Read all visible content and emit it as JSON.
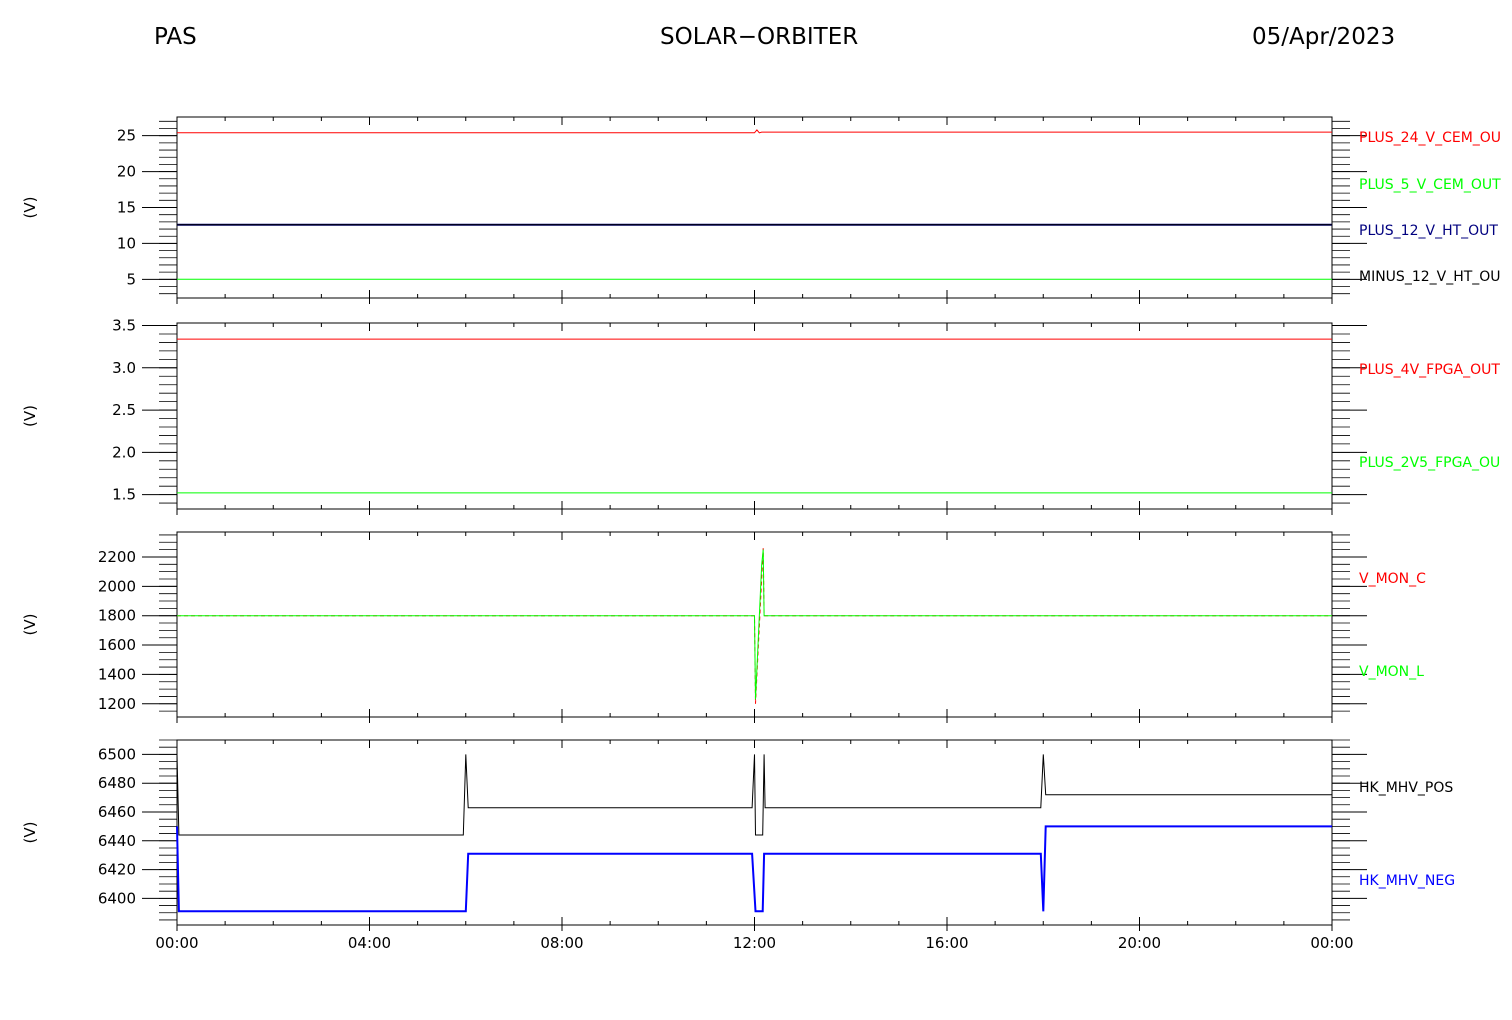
{
  "header": {
    "left": "PAS",
    "center": "SOLAR−ORBITER",
    "right": "05/Apr/2023"
  },
  "colors": {
    "red": "#ff0000",
    "green": "#00ff00",
    "navy": "#00007f",
    "black": "#000000",
    "blue": "#0000ff",
    "olive": "#7f7f00"
  },
  "chart_data": [
    {
      "type": "line",
      "ylabel": "(V)",
      "ylim": [
        2.4,
        27.6
      ],
      "yticks": [
        5,
        10,
        15,
        20,
        25
      ],
      "y_minor_step": 1,
      "xlim": [
        0,
        24
      ],
      "legend_placement": "right",
      "series": [
        {
          "name": "PLUS_24_V_CEM_OU",
          "color": "#ff0000",
          "width": 1,
          "points": [
            [
              0,
              25.4
            ],
            [
              12,
              25.4
            ],
            [
              12.05,
              25.8
            ],
            [
              12.1,
              25.4
            ],
            [
              12.15,
              25.5
            ],
            [
              24,
              25.5
            ]
          ]
        },
        {
          "name": "PLUS_5_V_CEM_OUT",
          "color": "#00ff00",
          "width": 1,
          "points": [
            [
              0,
              5.0
            ],
            [
              24,
              5.0
            ]
          ]
        },
        {
          "name": "PLUS_12_V_HT_OUT",
          "color": "#00007f",
          "width": 2,
          "points": [
            [
              0,
              12.6
            ],
            [
              24,
              12.6
            ]
          ]
        },
        {
          "name": "MINUS_12_V_HT_OU",
          "color": "#000000",
          "width": 1,
          "points": [
            [
              0,
              12.6
            ],
            [
              24,
              12.6
            ]
          ]
        }
      ]
    },
    {
      "type": "line",
      "ylabel": "(V)",
      "ylim": [
        1.33,
        3.53
      ],
      "yticks": [
        1.5,
        2.0,
        2.5,
        3.0,
        3.5
      ],
      "ytick_labels": [
        "1.5",
        "2.0",
        "2.5",
        "3.0",
        "3.5"
      ],
      "y_minor_step": 0.1,
      "xlim": [
        0,
        24
      ],
      "legend_placement": "right",
      "series": [
        {
          "name": "PLUS_4V_FPGA_OUT",
          "color": "#ff0000",
          "width": 1,
          "points": [
            [
              0,
              3.34
            ],
            [
              24,
              3.34
            ]
          ]
        },
        {
          "name": "PLUS_2V5_FPGA_OU",
          "color": "#00ff00",
          "width": 1,
          "points": [
            [
              0,
              1.52
            ],
            [
              24,
              1.52
            ]
          ]
        }
      ]
    },
    {
      "type": "line",
      "ylabel": "(V)",
      "ylim": [
        1110,
        2370
      ],
      "yticks": [
        1200,
        1400,
        1600,
        1800,
        2000,
        2200
      ],
      "y_minor_step": 50,
      "xlim": [
        0,
        24
      ],
      "legend_placement": "right",
      "series": [
        {
          "name": "V_MON_C",
          "color": "#ff0000",
          "width": 1,
          "dash": "4,3",
          "points": [
            [
              0,
              1800
            ],
            [
              12.0,
              1800
            ],
            [
              12.02,
              1200
            ],
            [
              12.18,
              2260
            ],
            [
              12.2,
              1800
            ],
            [
              24,
              1800
            ]
          ]
        },
        {
          "name": "V_MON_L",
          "color": "#00ff00",
          "width": 1,
          "points": [
            [
              0,
              1800
            ],
            [
              12.0,
              1800
            ],
            [
              12.02,
              1230
            ],
            [
              12.15,
              2150
            ],
            [
              12.18,
              2250
            ],
            [
              12.2,
              1800
            ],
            [
              24,
              1800
            ]
          ]
        }
      ]
    },
    {
      "type": "line",
      "ylabel": "(V)",
      "ylim": [
        6381.5,
        6510
      ],
      "yticks": [
        6400,
        6420,
        6440,
        6460,
        6480,
        6500
      ],
      "y_minor_step": 5,
      "xlim": [
        0,
        24
      ],
      "legend_placement": "right",
      "series": [
        {
          "name": "HK_MHV_POS",
          "color": "#000000",
          "width": 1,
          "points": [
            [
              0,
              6500
            ],
            [
              0.04,
              6444
            ],
            [
              5.95,
              6444
            ],
            [
              6.0,
              6500
            ],
            [
              6.05,
              6463
            ],
            [
              11.95,
              6463
            ],
            [
              12.0,
              6500
            ],
            [
              12.02,
              6444
            ],
            [
              12.17,
              6444
            ],
            [
              12.2,
              6500
            ],
            [
              12.22,
              6463
            ],
            [
              17.95,
              6463
            ],
            [
              18.0,
              6500
            ],
            [
              18.05,
              6472
            ],
            [
              24,
              6472
            ]
          ]
        },
        {
          "name": "HK_MHV_NEG",
          "color": "#0000ff",
          "width": 2,
          "points": [
            [
              0,
              6450
            ],
            [
              0.04,
              6391
            ],
            [
              5.95,
              6391
            ],
            [
              6.0,
              6391
            ],
            [
              6.05,
              6431
            ],
            [
              11.95,
              6431
            ],
            [
              12.02,
              6391
            ],
            [
              12.17,
              6391
            ],
            [
              12.2,
              6431
            ],
            [
              17.95,
              6431
            ],
            [
              18.0,
              6391
            ],
            [
              18.05,
              6450
            ],
            [
              24,
              6450
            ]
          ]
        }
      ]
    }
  ],
  "x_axis": {
    "ticks": [
      0,
      4,
      8,
      12,
      16,
      20,
      24
    ],
    "tick_labels": [
      "00:00",
      "04:00",
      "08:00",
      "12:00",
      "16:00",
      "20:00",
      "00:00"
    ],
    "minor_step": 1
  }
}
